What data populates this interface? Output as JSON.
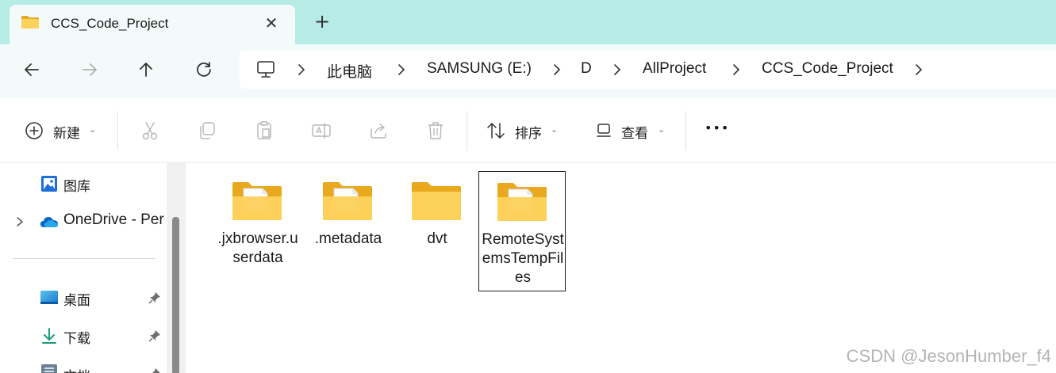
{
  "window": {
    "tab_title": "CCS_Code_Project",
    "close_glyph": "✕",
    "new_tab_glyph": "+"
  },
  "address": {
    "crumbs": [
      "此电脑",
      "SAMSUNG (E:)",
      "D",
      "AllProject",
      "CCS_Code_Project"
    ]
  },
  "toolbar": {
    "new_label": "新建",
    "sort_label": "排序",
    "view_label": "查看",
    "more_label": "•••",
    "caret": "⌄"
  },
  "sidebar": {
    "items": [
      {
        "label": "图库",
        "icon": "gallery-icon"
      },
      {
        "label": "OneDrive - Per",
        "icon": "onedrive-icon"
      },
      {
        "label": "桌面",
        "icon": "desktop-icon"
      },
      {
        "label": "下载",
        "icon": "download-icon"
      },
      {
        "label": "文档",
        "icon": "documents-icon"
      }
    ]
  },
  "files": [
    {
      "name": ".jxbrowser.userdata",
      "has_files": true,
      "selected": false
    },
    {
      "name": ".metadata",
      "has_files": true,
      "selected": false
    },
    {
      "name": "dvt",
      "has_files": false,
      "selected": false
    },
    {
      "name": "RemoteSystemsTempFiles",
      "has_files": true,
      "selected": true
    }
  ],
  "watermark": "CSDN @JesonHumber_f4",
  "colors": {
    "tabbar_bg": "#b6ebe6",
    "nav_bg": "#f3fbfa",
    "folder_yellow": "#f8c84a"
  }
}
